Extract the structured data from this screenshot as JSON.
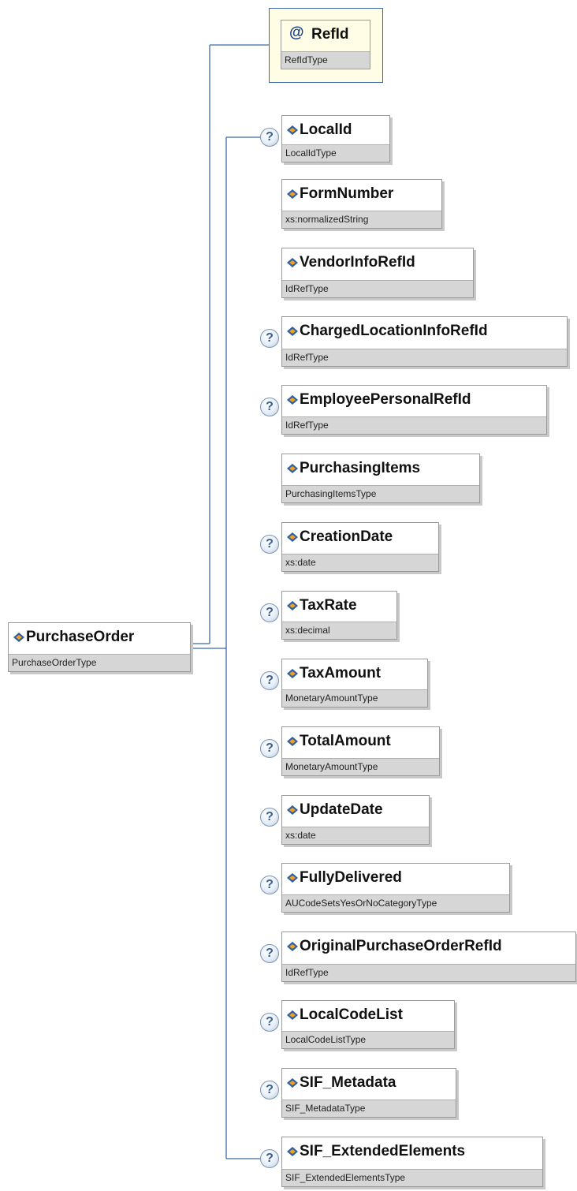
{
  "root": {
    "name": "PurchaseOrder",
    "type": "PurchaseOrderType",
    "icon": "element-diamond-icon"
  },
  "attribute": {
    "symbol": "@",
    "name": "RefId",
    "type": "RefIdType"
  },
  "optional_marker": "?",
  "elements": [
    {
      "name": "LocalId",
      "type": "LocalIdType",
      "optional": true
    },
    {
      "name": "FormNumber",
      "type": "xs:normalizedString",
      "optional": false
    },
    {
      "name": "VendorInfoRefId",
      "type": "IdRefType",
      "optional": false
    },
    {
      "name": "ChargedLocationInfoRefId",
      "type": "IdRefType",
      "optional": true
    },
    {
      "name": "EmployeePersonalRefId",
      "type": "IdRefType",
      "optional": true
    },
    {
      "name": "PurchasingItems",
      "type": "PurchasingItemsType",
      "optional": false
    },
    {
      "name": "CreationDate",
      "type": "xs:date",
      "optional": true
    },
    {
      "name": "TaxRate",
      "type": "xs:decimal",
      "optional": true
    },
    {
      "name": "TaxAmount",
      "type": "MonetaryAmountType",
      "optional": true
    },
    {
      "name": "TotalAmount",
      "type": "MonetaryAmountType",
      "optional": true
    },
    {
      "name": "UpdateDate",
      "type": "xs:date",
      "optional": true
    },
    {
      "name": "FullyDelivered",
      "type": "AUCodeSetsYesOrNoCategoryType",
      "optional": true
    },
    {
      "name": "OriginalPurchaseOrderRefId",
      "type": "IdRefType",
      "optional": true
    },
    {
      "name": "LocalCodeList",
      "type": "LocalCodeListType",
      "optional": true
    },
    {
      "name": "SIF_Metadata",
      "type": "SIF_MetadataType",
      "optional": true
    },
    {
      "name": "SIF_ExtendedElements",
      "type": "SIF_ExtendedElementsType",
      "optional": true
    }
  ],
  "colors": {
    "connector": "#3b6aa8",
    "attribute_bg": "#fffde6",
    "type_band": "#d6d6d6",
    "icon_blue": "#2e5fa3",
    "icon_orange": "#f0a020"
  }
}
